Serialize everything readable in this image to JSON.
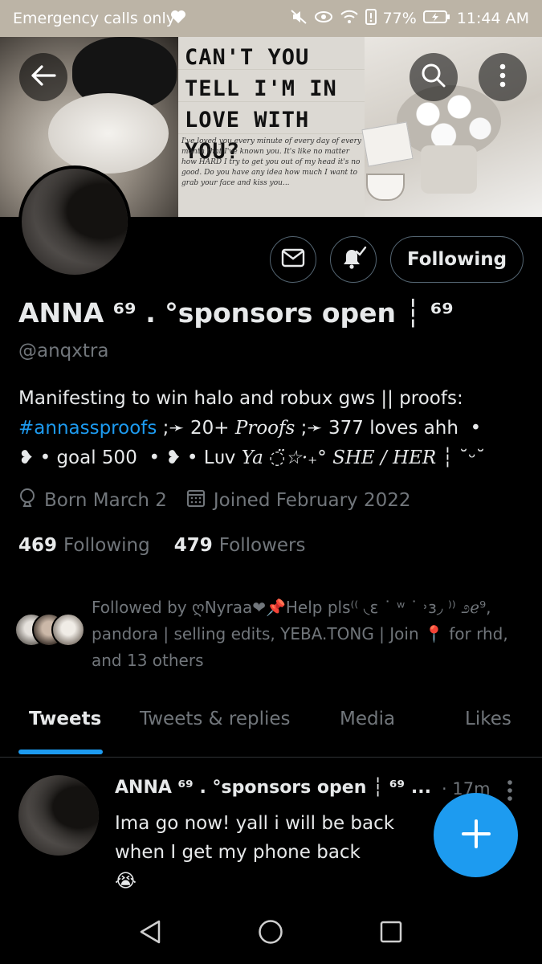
{
  "status_bar": {
    "carrier": "Emergency calls only",
    "battery": "77%",
    "time": "11:44 AM"
  },
  "banner": {
    "headline": "CAN'T YOU TELL I'M IN LOVE WITH YOU?",
    "scrawl": "I've loved you every minute of every day of every month that I've known you. It's like no matter how HARD I try to get you out of my head it's no good. Do you have any idea how much I want to grab your face and kiss you..."
  },
  "profile": {
    "display_name": "ANNA ⁶⁹ . °sponsors open ┆ ⁶⁹",
    "handle": "@anqxtra",
    "bio": {
      "line1": "Manifesting to win halo and robux gws || proofs:",
      "hashtag": "#annassproofs",
      "line2_rest": " ;➛ 20+ ",
      "proofs_word": "Proofs",
      "line2_end": " ;➛ 377 loves ahh  •",
      "line3_a": "❥ • goal 500  • ❥ • Lᴜᴠ ",
      "line3_serif": "Ya ◌̈☆·₊° SHE / HER",
      "line3_end": " ┆ ˘ᵕ˘"
    },
    "born": "Born March 2",
    "joined": "Joined February 2022",
    "following_count": "469",
    "following_label": "Following",
    "followers_count": "479",
    "followers_label": "Followers",
    "followed_by": "Followed by ღNyraa❤📌Help pls⁽⁽ ◟ε ˙ ʷ ˙ ˒ɜ◞ ⁾⁾ ೨ℯ⁹, pandora | selling edits, YEBA.TONG | Join 📍 for rhd, and 13 others"
  },
  "actions": {
    "following_button": "Following"
  },
  "tabs": [
    {
      "label": "Tweets"
    },
    {
      "label": "Tweets & replies"
    },
    {
      "label": "Media"
    },
    {
      "label": "Likes"
    }
  ],
  "tweet": {
    "name": "ANNA ⁶⁹ . °sponsors open ┆ ⁶⁹ ...",
    "time": "· 17m",
    "text": "Ima go now! yall i will be back when I get my phone back",
    "emoji": "😭"
  },
  "icons": {
    "back": "back-arrow-icon",
    "search": "search-icon",
    "more": "more-vertical-icon",
    "mail": "mail-icon",
    "bell": "notification-bell-icon",
    "location": "location-icon",
    "calendar": "calendar-icon",
    "compose": "plus-icon"
  },
  "colors": {
    "accent": "#1d9bf0",
    "background": "#000000",
    "status_bar": "#bcb4a6"
  }
}
